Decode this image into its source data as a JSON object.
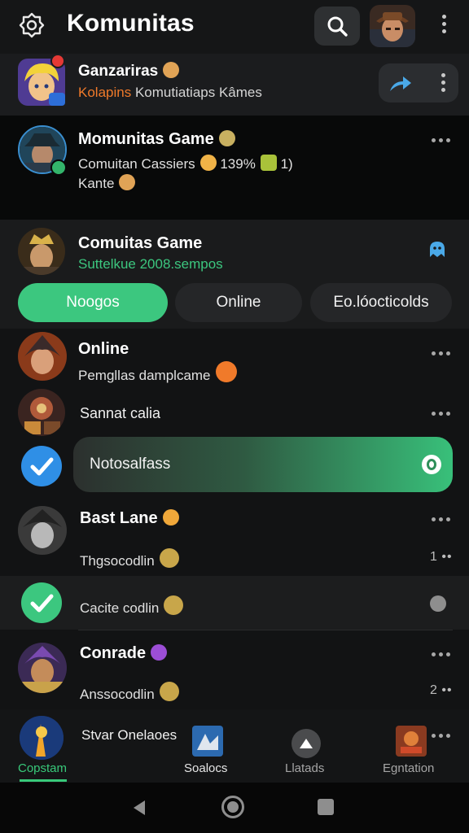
{
  "header": {
    "title": "Komunitas"
  },
  "top_game": {
    "name": "Ganzariras",
    "tag": "Kolapins",
    "subtitle": "Komutiatiaps Kâmes"
  },
  "chats": [
    {
      "name": "Momunitas Game",
      "line1": "Comuitan Cassiers",
      "line1_suffix": "139%",
      "line1_end": "1)",
      "line2": "Kante"
    }
  ],
  "community": {
    "name": "Comuitas Game",
    "status": "Suttelkue 2008.sempos"
  },
  "filters": [
    {
      "label": "Noogos",
      "active": true
    },
    {
      "label": "Online",
      "active": false
    },
    {
      "label": "Eo.lóocticolds",
      "active": false
    }
  ],
  "list": {
    "online_name": "Online",
    "online_msg": "Pemgllas damplcame",
    "sannat": "Sannat calia",
    "toast": "Notosalfass",
    "bast_name": "Bast Lane",
    "bast_msg": "Thgsocodlin",
    "bast_count": "1",
    "cacite": "Cacite codlin",
    "conrade_name": "Conrade",
    "conrade_msg": "Anssocodlin",
    "conrade_count": "2",
    "stvar": "Stvar Onelaoes"
  },
  "nav": {
    "items": [
      "Copstam",
      "Soalocs",
      "Llatads",
      "Egntation"
    ],
    "active_color": "#38c97a"
  },
  "colors": {
    "accent_green": "#3cc77f",
    "accent_blue": "#4aa9e8",
    "orange": "#f07a2a"
  }
}
